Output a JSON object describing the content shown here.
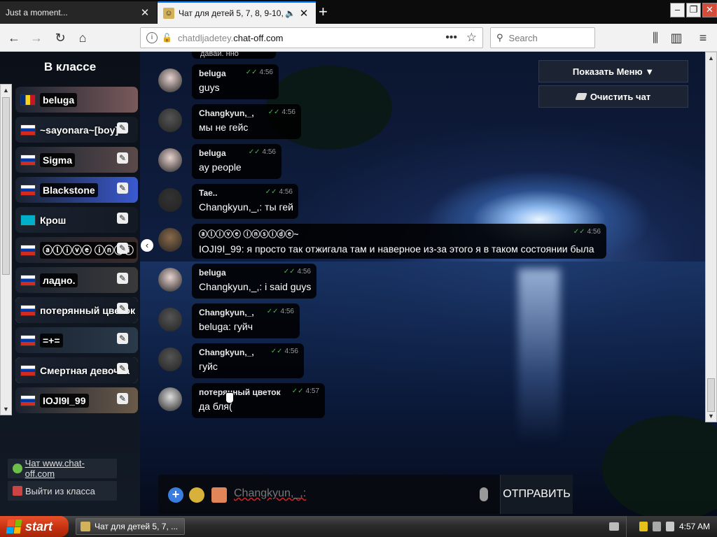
{
  "browser": {
    "tabs": [
      {
        "title": "Just a moment...",
        "active": false
      },
      {
        "title": "Чат для детей 5, 7, 8, 9-10,",
        "active": true
      }
    ],
    "url_host": "chatdljadetey.",
    "url_domain": "chat-off.com",
    "search_placeholder": "Search"
  },
  "sidebar": {
    "title": "В классе",
    "users": [
      {
        "name": "beluga",
        "flag": "ro",
        "pm": false,
        "bg": "#7a5a5a"
      },
      {
        "name": "~sayonara~[boy]",
        "flag": "ru",
        "pm": true,
        "bg": "#141a24"
      },
      {
        "name": "Sigma",
        "flag": "ru",
        "pm": true,
        "bg": "#5a4a4a"
      },
      {
        "name": "Blackstone",
        "flag": "ru",
        "pm": true,
        "bg": "#3a5ad0"
      },
      {
        "name": "Крош",
        "flag": "kz",
        "pm": true,
        "bg": "#141a24"
      },
      {
        "name": "ⓐⓛⓘⓥⓔ ⓘⓝⓢⓘ",
        "flag": "ru",
        "pm": true,
        "bg": "#3a2a2a"
      },
      {
        "name": "ладно.",
        "flag": "ru",
        "pm": true,
        "bg": "#3a3a3a"
      },
      {
        "name": "потерянный цветок",
        "flag": "ru",
        "pm": true,
        "bg": "#141a24",
        "selected": true
      },
      {
        "name": "=+=",
        "flag": "ru",
        "pm": true,
        "bg": "#2a3a4a"
      },
      {
        "name": "Смертная девочка",
        "flag": "ru",
        "pm": true,
        "bg": "#141a24",
        "selected": true
      },
      {
        "name": "IOJI9I_99",
        "flag": "ru",
        "pm": true,
        "bg": "#6a5a4a"
      }
    ],
    "links": {
      "site": "Чат www.chat-off.com",
      "leave": "Выйти из класса"
    }
  },
  "menu": {
    "show_menu": "Показать Меню ▼",
    "clear_chat": "Очистить чат"
  },
  "chat": {
    "partial_top": "давай. нно",
    "messages": [
      {
        "author": "beluga",
        "time": "4:56",
        "text": "guys",
        "avatar": "#e8d3d0"
      },
      {
        "author": "Changkyun,_,",
        "time": "4:56",
        "text": "мы не гейс",
        "avatar": "#555"
      },
      {
        "author": "beluga",
        "time": "4:56",
        "text": "ay people",
        "avatar": "#e8d3d0"
      },
      {
        "author": "Tae..",
        "time": "4:56",
        "text": "Changkyun,_,: ты гей",
        "avatar": "#333"
      },
      {
        "author": "ⓐⓛⓘⓥⓔ ⓘⓝⓢⓘⓓⓔ~",
        "time": "4:56",
        "text": "IOJI9I_99: я просто так отжигала там и наверное из-за этого я в таком состоянии была",
        "avatar": "#8a6a4a"
      },
      {
        "author": "beluga",
        "time": "4:56",
        "text": "Changkyun,_,: i said guys",
        "avatar": "#e8d3d0"
      },
      {
        "author": "Changkyun,_,",
        "time": "4:56",
        "text": "beluga: гуйч",
        "avatar": "#555"
      },
      {
        "author": "Changkyun,_,",
        "time": "4:56",
        "text": "гуйс",
        "avatar": "#555"
      },
      {
        "author": "потерянный цветок",
        "time": "4:57",
        "text": "да бля(",
        "avatar": "#ddd"
      }
    ]
  },
  "input": {
    "text": "Changkyun,_,:",
    "send_label": "ОТПРАВИТЬ"
  },
  "taskbar": {
    "start_label": "start",
    "task_title": "Чат для детей 5, 7, ...",
    "clock": "4:57 AM"
  }
}
